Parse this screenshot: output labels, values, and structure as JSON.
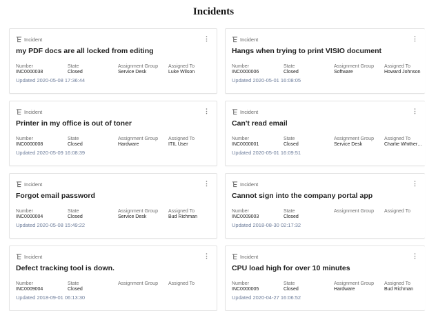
{
  "page": {
    "title": "Incidents"
  },
  "labels": {
    "type": "Incident",
    "number": "Number",
    "state": "State",
    "group": "Assignment Group",
    "assigned": "Assigned To",
    "more": "⋮"
  },
  "cards": [
    {
      "short": "my PDF docs are all locked from editing",
      "number": "INC0000038",
      "state": "Closed",
      "group": "Service Desk",
      "assigned": "Luke Wilson",
      "updated": "Updated 2020-05-08 17:36:44"
    },
    {
      "short": "Hangs when trying to print VISIO document",
      "number": "INC0000006",
      "state": "Closed",
      "group": "Software",
      "assigned": "Howard Johnson",
      "updated": "Updated 2020-05-01 16:08:05"
    },
    {
      "short": "Printer in my office is out of toner",
      "number": "INC0000008",
      "state": "Closed",
      "group": "Hardware",
      "assigned": "ITIL User",
      "updated": "Updated 2020-05-09 16:08:39"
    },
    {
      "short": "Can't read email",
      "number": "INC0000001",
      "state": "Closed",
      "group": "Service Desk",
      "assigned": "Charlie Whither…",
      "updated": "Updated 2020-05-01 16:09:51"
    },
    {
      "short": "Forgot email password",
      "number": "INC0000004",
      "state": "Closed",
      "group": "Service Desk",
      "assigned": "Bud Richman",
      "updated": "Updated 2020-05-08 15:49:22"
    },
    {
      "short": "Cannot sign into the company portal app",
      "number": "INC0009003",
      "state": "Closed",
      "group": "",
      "assigned": "",
      "updated": "Updated 2018-08-30 02:17:32"
    },
    {
      "short": "Defect tracking tool is down.",
      "number": "INC0009004",
      "state": "Closed",
      "group": "",
      "assigned": "",
      "updated": "Updated 2018-09-01 06:13:30"
    },
    {
      "short": "CPU load high for over 10 minutes",
      "number": "INC0000005",
      "state": "Closed",
      "group": "Hardware",
      "assigned": "Bud Richman",
      "updated": "Updated 2020-04-27 16:06:52"
    }
  ]
}
